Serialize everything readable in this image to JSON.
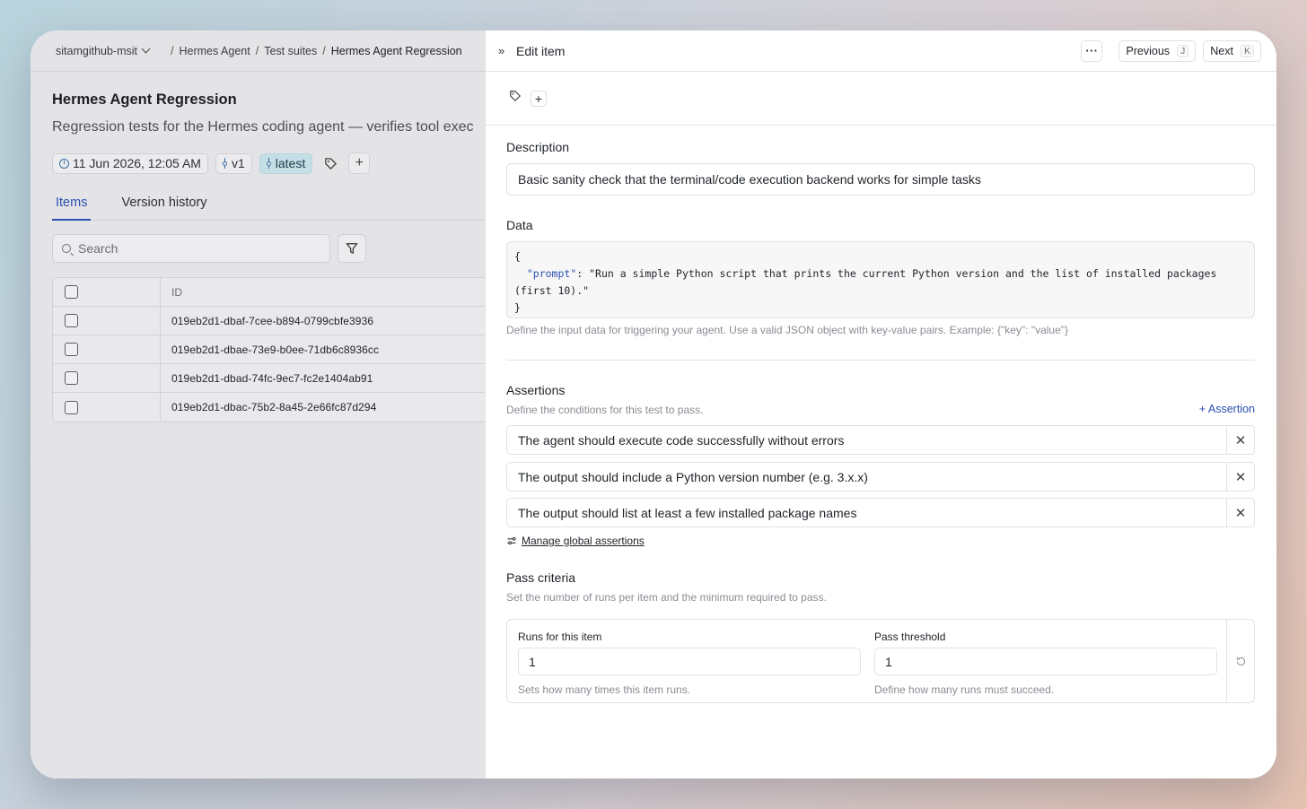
{
  "left": {
    "breadcrumb": {
      "org": "sitamgithub-msit",
      "items": [
        "Hermes Agent",
        "Test suites",
        "Hermes Agent Regression"
      ]
    },
    "title": "Hermes Agent Regression",
    "description": "Regression tests for the Hermes coding agent — verifies tool exec",
    "meta": {
      "date": "11 Jun 2026, 12:05 AM",
      "version": "v1",
      "tag": "latest"
    },
    "tabs": [
      "Items",
      "Version history"
    ],
    "search_placeholder": "Search",
    "table": {
      "id_header": "ID",
      "rows": [
        "019eb2d1-dbaf-7cee-b894-0799cbfe3936",
        "019eb2d1-dbae-73e9-b0ee-71db6c8936cc",
        "019eb2d1-dbad-74fc-9ec7-fc2e1404ab91",
        "019eb2d1-dbac-75b2-8a45-2e66fc87d294"
      ]
    }
  },
  "panel": {
    "title": "Edit item",
    "more_label": "···",
    "previous_label": "Previous",
    "previous_key": "J",
    "next_label": "Next",
    "next_key": "K",
    "description_label": "Description",
    "description_value": "Basic sanity check that the terminal/code execution backend works for simple tasks",
    "data_label": "Data",
    "data_open": "{",
    "data_key": "\"prompt\"",
    "data_value": ": \"Run a simple Python script that prints the current Python version and the list of installed packages (first 10).\"",
    "data_close": "}",
    "data_help": "Define the input data for triggering your agent. Use a valid JSON object with key-value pairs. Example: {\"key\": \"value\"}",
    "assertions_label": "Assertions",
    "assertions_help": "Define the conditions for this test to pass.",
    "add_assertion": "+ Assertion",
    "assertions": [
      "The agent should execute code successfully without errors",
      "The output should include a Python version number (e.g. 3.x.x)",
      "The output should list at least a few installed package names"
    ],
    "manage_link": "Manage global assertions",
    "pass_label": "Pass criteria",
    "pass_help": "Set the number of runs per item and the minimum required to pass.",
    "runs_label": "Runs for this item",
    "runs_value": "1",
    "runs_help": "Sets how many times this item runs.",
    "threshold_label": "Pass threshold",
    "threshold_value": "1",
    "threshold_help": "Define how many runs must succeed."
  }
}
